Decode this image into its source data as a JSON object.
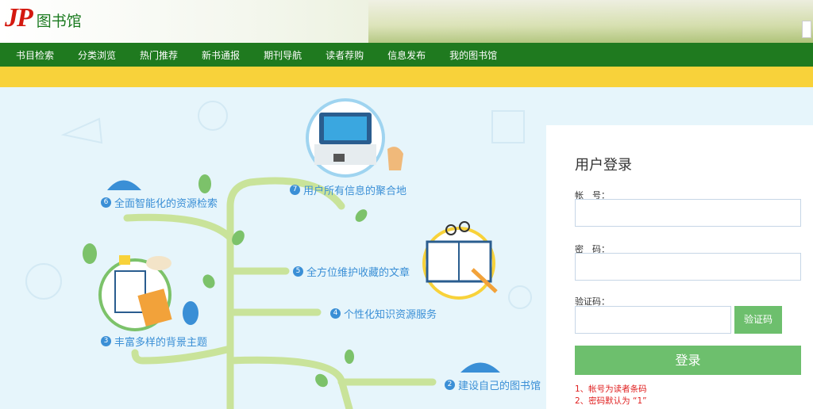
{
  "header": {
    "logo_mark": "JP",
    "logo_name": "图书馆"
  },
  "nav": {
    "items": [
      {
        "label": "书目检索"
      },
      {
        "label": "分类浏览"
      },
      {
        "label": "热门推荐"
      },
      {
        "label": "新书通报"
      },
      {
        "label": "期刊导航"
      },
      {
        "label": "读者荐购"
      },
      {
        "label": "信息发布"
      },
      {
        "label": "我的图书馆"
      }
    ]
  },
  "features": [
    {
      "num": "2",
      "label": "建设自己的图书馆"
    },
    {
      "num": "3",
      "label": "丰富多样的背景主题"
    },
    {
      "num": "4",
      "label": "个性化知识资源服务"
    },
    {
      "num": "5",
      "label": "全方位维护收藏的文章"
    },
    {
      "num": "6",
      "label": "全面智能化的资源检索"
    },
    {
      "num": "7",
      "label": "用户所有信息的聚合地"
    }
  ],
  "login": {
    "title": "用户登录",
    "account_label": "帐　号：",
    "password_label": "密　码：",
    "captcha_label": "验证码：",
    "captcha_button": "验证码",
    "submit_label": "登录",
    "notes": [
      "1、帐号为读者条码",
      "2、密码默认为 “1”"
    ]
  },
  "colors": {
    "nav_green": "#1f7a1f",
    "accent_yellow": "#f8d23a",
    "button_green": "#6dbf6d",
    "feature_blue": "#3a8fd6",
    "note_red": "#e02020",
    "logo_red": "#d4180f"
  }
}
